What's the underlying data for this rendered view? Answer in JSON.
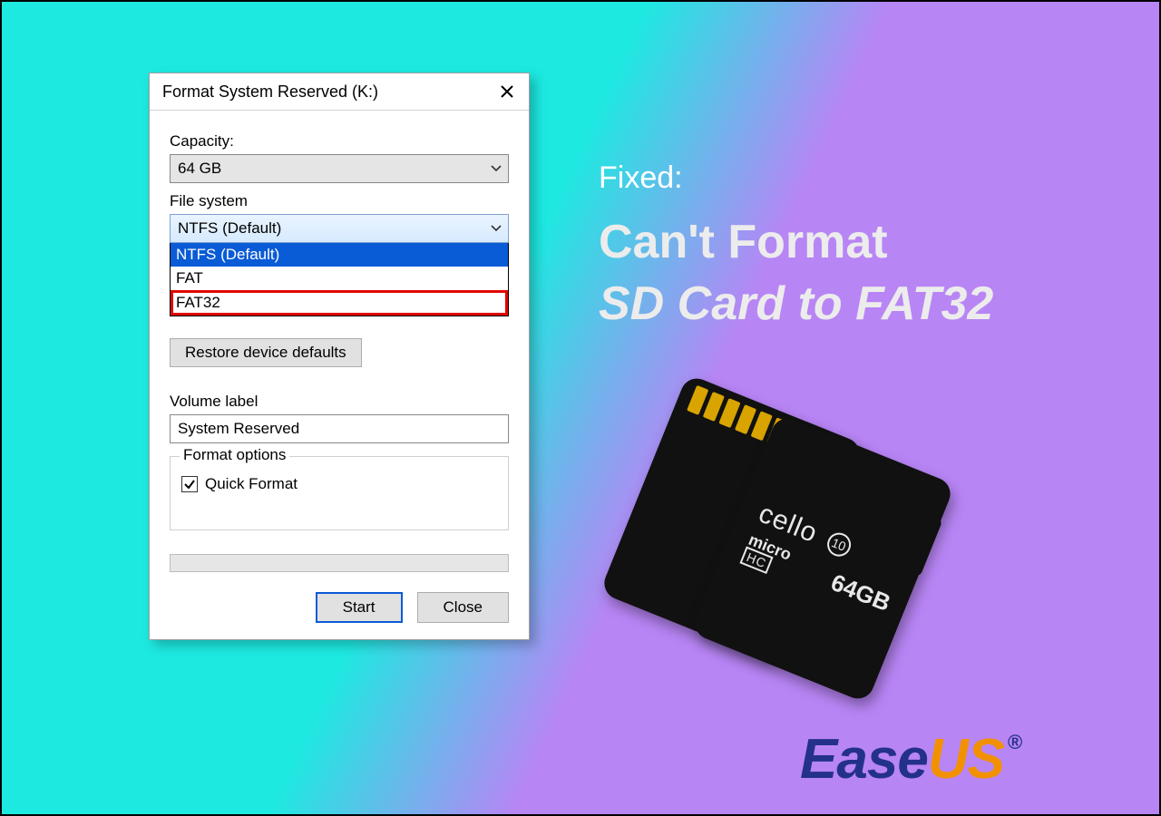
{
  "dialog": {
    "title": "Format System Reserved (K:)",
    "capacity_label": "Capacity:",
    "capacity_value": "64 GB",
    "filesystem_label": "File system",
    "filesystem_value": "NTFS (Default)",
    "filesystem_options": {
      "ntfs": "NTFS (Default)",
      "fat": "FAT",
      "fat32": "FAT32"
    },
    "restore_defaults": "Restore device defaults",
    "volume_label_label": "Volume label",
    "volume_label_value": "System Reserved",
    "format_options_legend": "Format options",
    "quick_format_label": "Quick Format",
    "quick_format_checked": true,
    "start_button": "Start",
    "close_button": "Close"
  },
  "headline": {
    "fixed": "Fixed:",
    "line1": "Can't Format",
    "line2": "SD Card to FAT32"
  },
  "sdcard": {
    "brand": "cello",
    "micro": "micro",
    "sdhc": "HC",
    "speed_class": "10",
    "capacity": "64GB"
  },
  "logo": {
    "ease": "Ease",
    "us": "US",
    "reg": "®"
  }
}
